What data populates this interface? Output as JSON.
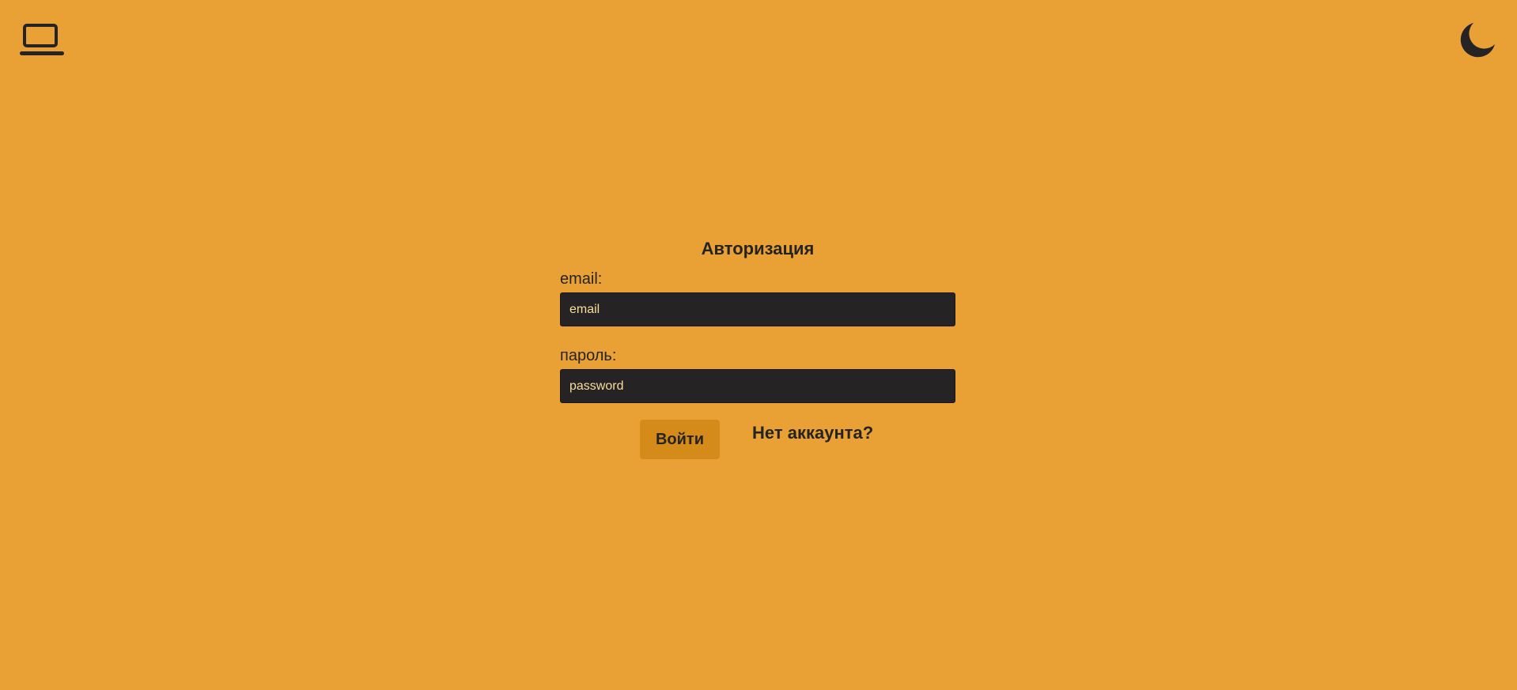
{
  "header": {
    "logo_icon": "laptop-icon",
    "theme_icon": "moon-icon"
  },
  "auth": {
    "title": "Авторизация",
    "email": {
      "label": "email:",
      "placeholder": "email",
      "value": ""
    },
    "password": {
      "label": "пароль:",
      "placeholder": "password",
      "value": ""
    },
    "login_label": "Войти",
    "register_link": "Нет аккаунта?"
  },
  "colors": {
    "background": "#e9a135",
    "input_bg": "#262324",
    "input_text": "#f6df9c",
    "button_bg": "#d48b1a",
    "text": "#262324"
  }
}
